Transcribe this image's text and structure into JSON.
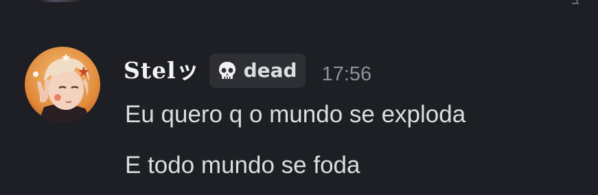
{
  "message": {
    "author": {
      "display_name": "Stelッ",
      "avatar_icon": "anime-avatar-icon"
    },
    "role_tag": {
      "icon": "skull-icon",
      "label": "dead"
    },
    "timestamp": "17:56",
    "lines": [
      "Eu quero q o mundo se exploda",
      "E todo mundo se foda"
    ]
  },
  "colors": {
    "background": "#1e1f24",
    "text_primary": "#dbdee1",
    "username": "#f2f3f5",
    "timestamp": "#8e9297",
    "role_tag_bg": "#2d2f35"
  }
}
